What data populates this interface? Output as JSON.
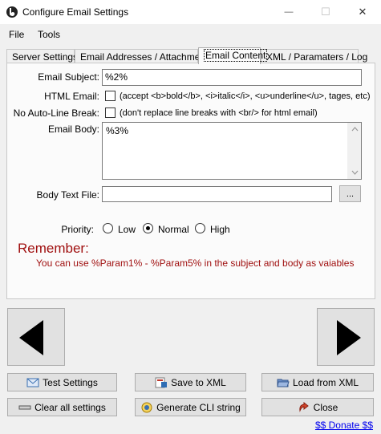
{
  "window": {
    "title": "Configure Email Settings",
    "minimize": "—",
    "maximize": "☐",
    "close": "✕"
  },
  "menu": {
    "file": "File",
    "tools": "Tools"
  },
  "tabs": [
    {
      "label": "Server Settings"
    },
    {
      "label": "Email Addresses / Attachment"
    },
    {
      "label": "Email Content"
    },
    {
      "label": "XML / Paramaters / Log"
    }
  ],
  "content": {
    "subject_label": "Email Subject:",
    "subject_value": "%2%",
    "html_label": "HTML Email:",
    "html_note": "(accept <b>bold</b>, <i>italic</i>, <u>underline</u>, tages, etc)",
    "noauto_label": "No Auto-Line Break:",
    "noauto_note": "(don't replace line breaks with <br/> for html email)",
    "body_label": "Email Body:",
    "body_value": "%3%",
    "bodyfile_label": "Body Text File:",
    "bodyfile_value": "",
    "browse_label": "...",
    "priority_label": "Priority:",
    "priority_options": [
      "Low",
      "Normal",
      "High"
    ],
    "priority_selected": "Normal",
    "remember": "Remember:",
    "hint": "You can use %Param1% - %Param5% in the subject and body as vaiables"
  },
  "buttons": {
    "test": "Test Settings",
    "save_xml": "Save to XML",
    "load_xml": "Load from XML",
    "clear": "Clear all settings",
    "cli": "Generate CLI string",
    "close": "Close"
  },
  "donate": "$$ Donate $$"
}
